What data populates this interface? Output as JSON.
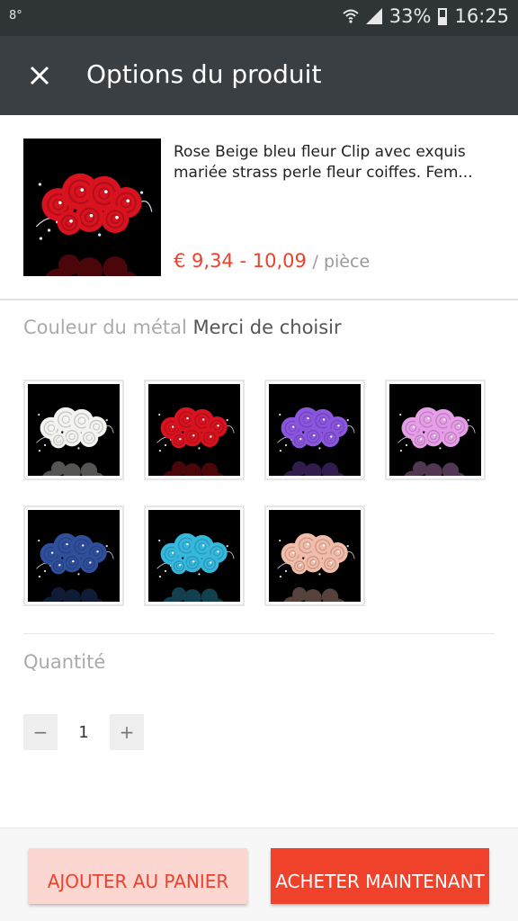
{
  "status_bar": {
    "left_indicator": "8°",
    "battery": "33%",
    "time": "16:25"
  },
  "app_bar": {
    "title": "Options du produit",
    "close_icon": "close-icon"
  },
  "product": {
    "name": "Rose Beige bleu fleur Clip avec exquis mariée strass perle fleur coiffes. Fem...",
    "price": "€ 9,34 - 10,09",
    "unit": "/ pièce"
  },
  "color_section": {
    "label": "Couleur du métal",
    "hint": "Merci de choisir",
    "swatches": [
      {
        "color": "#f3f3ef"
      },
      {
        "color": "#d8121e"
      },
      {
        "color": "#8b55e0"
      },
      {
        "color": "#e79de8"
      },
      {
        "color": "#2f4f9c"
      },
      {
        "color": "#35b8de"
      },
      {
        "color": "#f3bca8"
      }
    ]
  },
  "quantity": {
    "label": "Quantité",
    "minus": "−",
    "value": "1",
    "plus": "+"
  },
  "actions": {
    "add_to_cart": "AJOUTER AU PANIER",
    "buy_now": "ACHETER MAINTENANT"
  },
  "colors": {
    "accent": "#f0412a",
    "app_bar": "#3a3f43",
    "status_bar": "#2f3437"
  }
}
